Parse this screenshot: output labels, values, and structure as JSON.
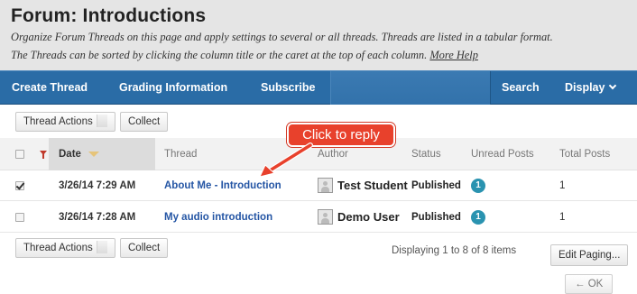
{
  "page": {
    "title": "Forum: Introductions",
    "description_line1": "Organize Forum Threads on this page and apply settings to several or all threads. Threads are listed in a tabular format.",
    "description_line2": "The Threads can be sorted by clicking the column title or the caret at the top of each column.",
    "more_help": "More Help"
  },
  "navbar": {
    "create_thread": "Create Thread",
    "grading_information": "Grading Information",
    "subscribe": "Subscribe",
    "search": "Search",
    "display": "Display"
  },
  "toolbar_top": {
    "thread_actions": "Thread Actions",
    "collect": "Collect"
  },
  "toolbar_bottom": {
    "thread_actions": "Thread Actions",
    "collect": "Collect"
  },
  "table": {
    "columns": {
      "date": "Date",
      "thread": "Thread",
      "author": "Author",
      "status": "Status",
      "unread_posts": "Unread Posts",
      "total_posts": "Total Posts"
    },
    "rows": [
      {
        "checked": true,
        "date": "3/26/14 7:29 AM",
        "thread": "About Me - Introduction",
        "author": "Test Student",
        "status": "Published",
        "unread": "1",
        "total": "1"
      },
      {
        "checked": false,
        "date": "3/26/14 7:28 AM",
        "thread": "My audio introduction",
        "author": "Demo User",
        "status": "Published",
        "unread": "1",
        "total": "1"
      }
    ]
  },
  "callout": {
    "text": "Click to reply",
    "color": "#e8412c"
  },
  "paging": {
    "text": "Displaying 1 to 8 of 8 items",
    "edit_paging": "Edit Paging..."
  },
  "ok_button": "← OK",
  "colors": {
    "navbar": "#2a6ca6",
    "header_bg": "#e5e5e5",
    "link": "#2455a4",
    "badge": "#2a93b0"
  }
}
